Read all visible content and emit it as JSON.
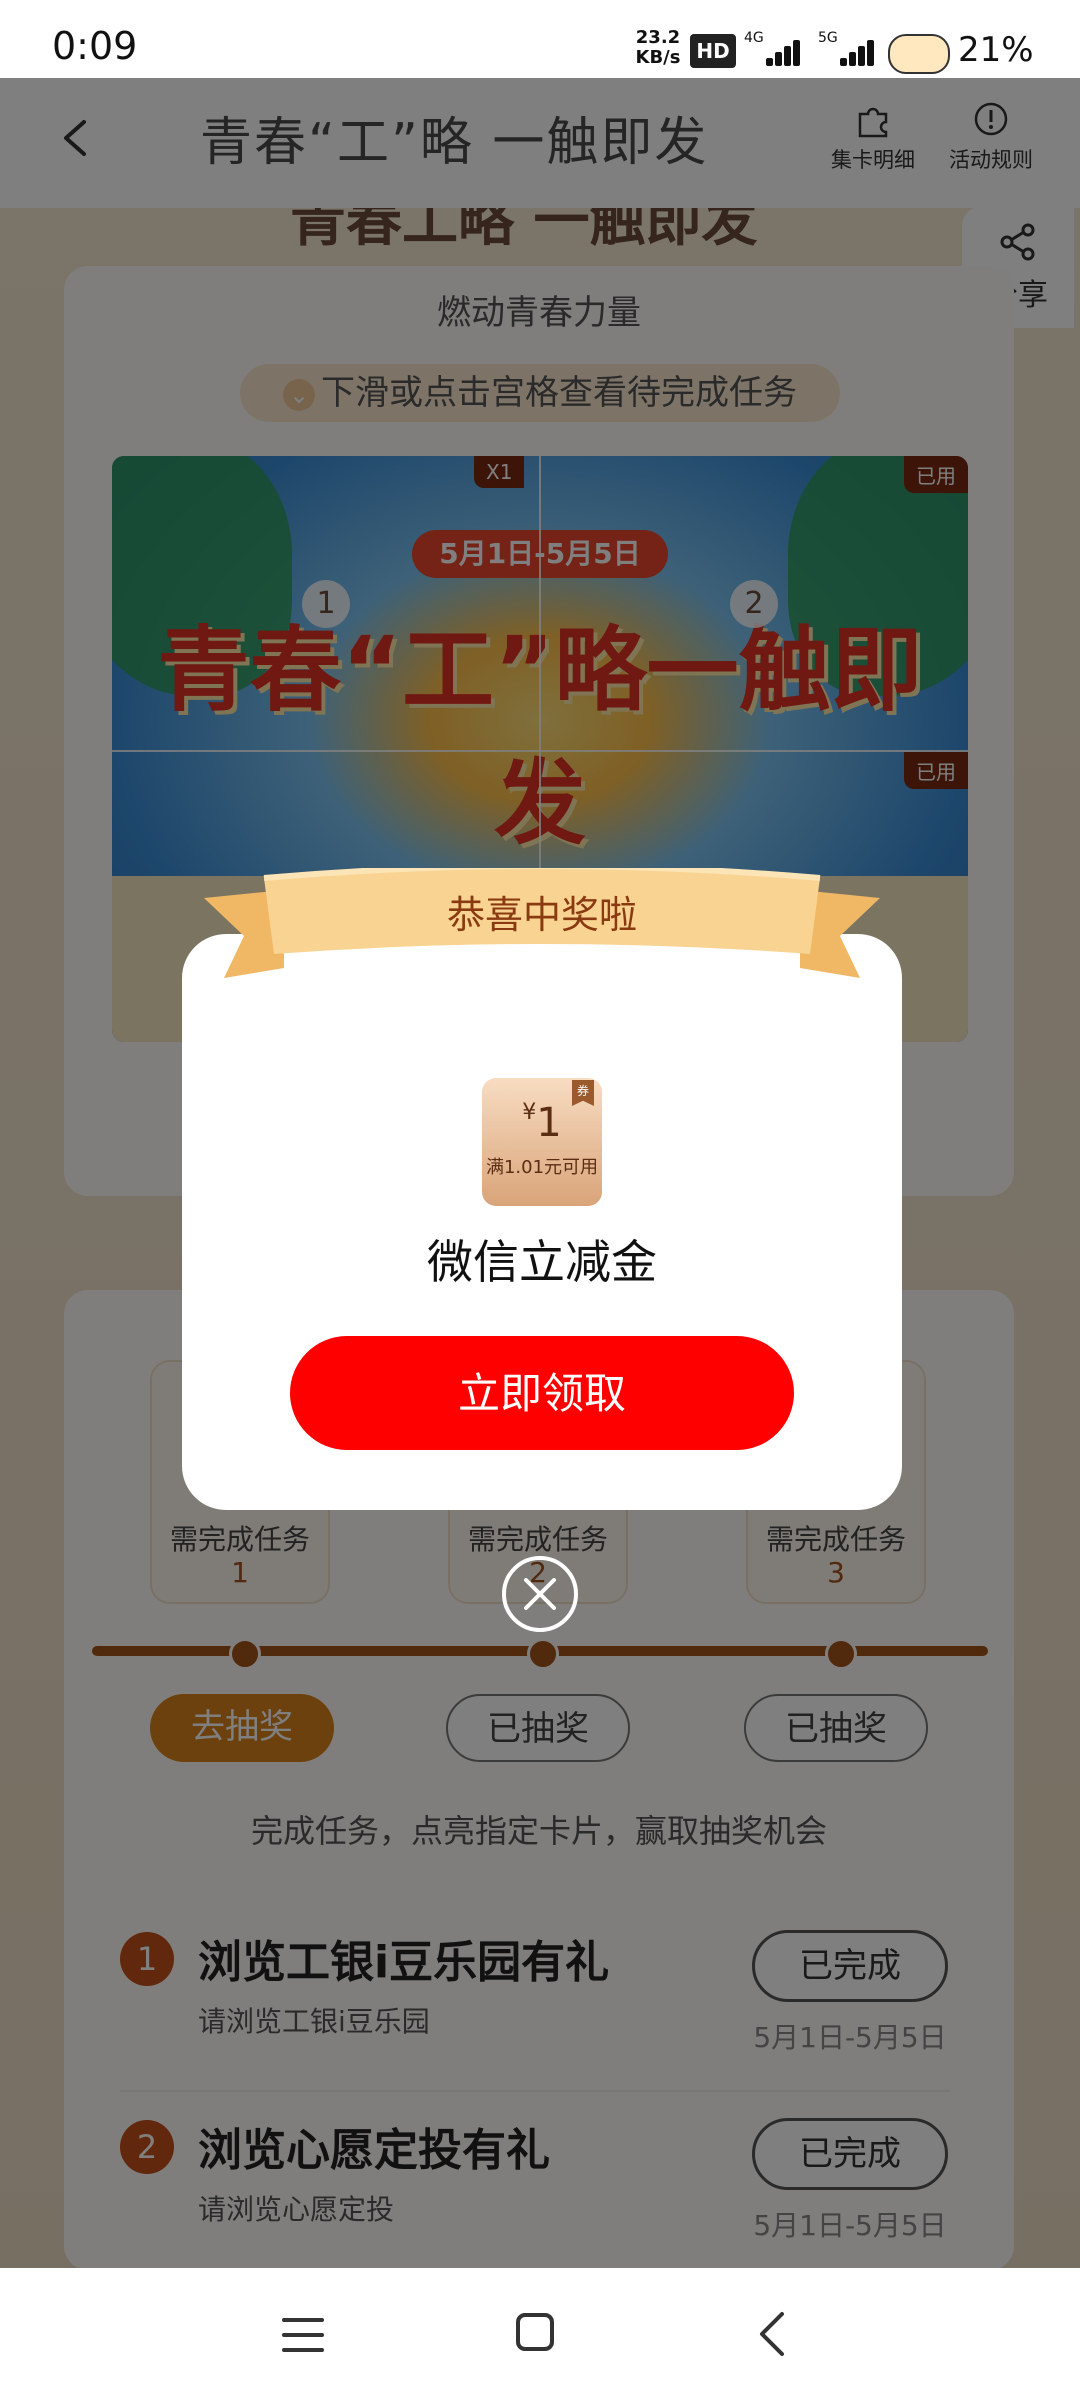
{
  "status_bar": {
    "time": "0:09",
    "net_speed": "23.2",
    "net_unit": "KB/s",
    "hd": "HD",
    "sim1": "4G",
    "sim2": "5G",
    "battery": "21%"
  },
  "header": {
    "title": "青春“工”略 一触即发",
    "card_detail": "集卡明细",
    "rules": "活动规则",
    "share": "分享"
  },
  "page": {
    "ghost_title": "青春工略 一触即发",
    "subtitle": "燃动青春力量",
    "hint": "下滑或点击宫格查看待完成任务",
    "poster": {
      "date": "5月1日-5月5日",
      "slogan": "青春“工”略一触即发",
      "tag_x1": "X1",
      "tag_used_1": "已用",
      "tag_used_2": "已用",
      "cell_1": "1",
      "cell_2": "2"
    },
    "tasks": [
      {
        "label": "需完成任务",
        "num": "1"
      },
      {
        "label": "需完成任务",
        "num": "2"
      },
      {
        "label": "需完成任务",
        "num": "3"
      }
    ],
    "draw_buttons": [
      "去抽奖",
      "已抽奖",
      "已抽奖"
    ],
    "tip": "完成任务，点亮指定卡片，赢取抽奖机会",
    "task_list": [
      {
        "num": "1",
        "title": "浏览工银i豆乐园有礼",
        "sub": "请浏览工银i豆乐园",
        "button": "已完成",
        "date": "5月1日-5月5日"
      },
      {
        "num": "2",
        "title": "浏览心愿定投有礼",
        "sub": "请浏览心愿定投",
        "button": "已完成",
        "date": "5月1日-5月5日"
      }
    ]
  },
  "modal": {
    "ribbon": "恭喜中奖啦",
    "coupon": {
      "currency": "¥",
      "amount": "1",
      "condition": "满1.01元可用",
      "corner": "券"
    },
    "prize_name": "微信立减金",
    "claim": "立即领取"
  },
  "icons": {
    "back": "chevron-left-icon",
    "card_detail": "puzzle-icon",
    "rules": "info-icon",
    "share": "share-icon",
    "close": "close-circle-icon"
  },
  "colors": {
    "claim_button": "#ff0000",
    "accent_brown": "#a3541a",
    "ribbon": "#f7c77c"
  }
}
